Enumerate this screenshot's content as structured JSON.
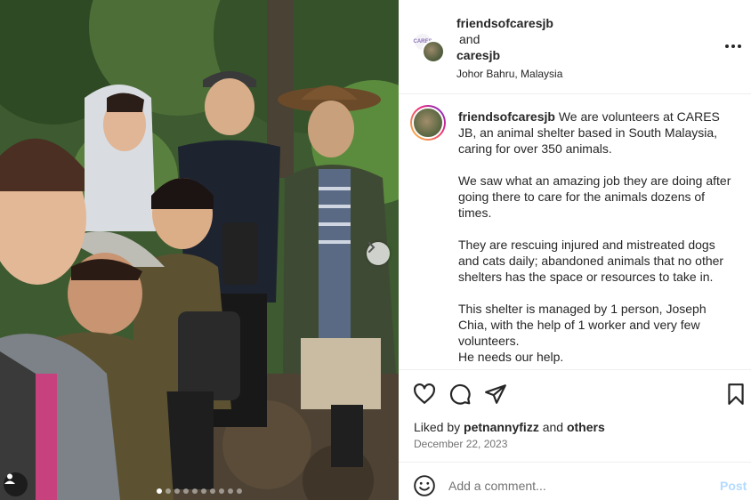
{
  "post": {
    "photo_alt": "Group of six volunteers smiling in a forest",
    "carousel": {
      "total": 10,
      "active_index": 0
    }
  },
  "header": {
    "user1": "friendsofcaresjb",
    "joiner": "and",
    "user2": "caresjb",
    "location": "Johor Bahru, Malaysia",
    "avatar_badge": "CARES"
  },
  "caption": {
    "username": "friendsofcaresjb",
    "paragraphs": [
      "We are volunteers at CARES JB, an animal shelter based in South Malaysia, caring for over 350 animals.",
      "We saw what an amazing job they are doing after going there to care for the animals dozens of times.",
      "They are rescuing injured and mistreated dogs and cats daily; abandoned animals that no other shelters has the space or resources to take in.",
      "This shelter is managed by 1 person, Joseph Chia, with the help of 1 worker and very few volunteers.",
      "He needs our help."
    ]
  },
  "actions": {
    "icons": [
      "heart-icon",
      "comment-icon",
      "share-icon",
      "bookmark-icon"
    ],
    "liked_prefix": "Liked by",
    "liked_user": "petnannyfizz",
    "liked_joiner": "and",
    "liked_others": "others",
    "date": "December 22, 2023"
  },
  "comment": {
    "placeholder": "Add a comment...",
    "post_label": "Post"
  },
  "colors": {
    "text": "#262626",
    "muted": "#737373",
    "divider": "#efefef",
    "post_disabled": "#b3dbff"
  }
}
